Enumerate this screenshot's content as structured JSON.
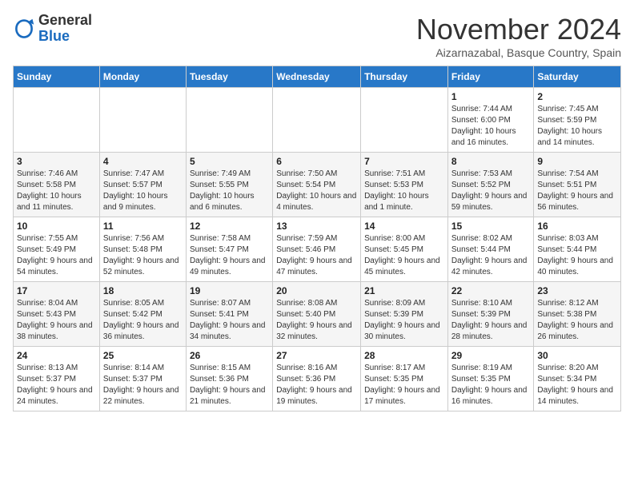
{
  "logo": {
    "general": "General",
    "blue": "Blue"
  },
  "header": {
    "month_year": "November 2024",
    "location": "Aizarnazabal, Basque Country, Spain"
  },
  "days_of_week": [
    "Sunday",
    "Monday",
    "Tuesday",
    "Wednesday",
    "Thursday",
    "Friday",
    "Saturday"
  ],
  "weeks": [
    [
      {
        "day": "",
        "info": ""
      },
      {
        "day": "",
        "info": ""
      },
      {
        "day": "",
        "info": ""
      },
      {
        "day": "",
        "info": ""
      },
      {
        "day": "",
        "info": ""
      },
      {
        "day": "1",
        "info": "Sunrise: 7:44 AM\nSunset: 6:00 PM\nDaylight: 10 hours and 16 minutes."
      },
      {
        "day": "2",
        "info": "Sunrise: 7:45 AM\nSunset: 5:59 PM\nDaylight: 10 hours and 14 minutes."
      }
    ],
    [
      {
        "day": "3",
        "info": "Sunrise: 7:46 AM\nSunset: 5:58 PM\nDaylight: 10 hours and 11 minutes."
      },
      {
        "day": "4",
        "info": "Sunrise: 7:47 AM\nSunset: 5:57 PM\nDaylight: 10 hours and 9 minutes."
      },
      {
        "day": "5",
        "info": "Sunrise: 7:49 AM\nSunset: 5:55 PM\nDaylight: 10 hours and 6 minutes."
      },
      {
        "day": "6",
        "info": "Sunrise: 7:50 AM\nSunset: 5:54 PM\nDaylight: 10 hours and 4 minutes."
      },
      {
        "day": "7",
        "info": "Sunrise: 7:51 AM\nSunset: 5:53 PM\nDaylight: 10 hours and 1 minute."
      },
      {
        "day": "8",
        "info": "Sunrise: 7:53 AM\nSunset: 5:52 PM\nDaylight: 9 hours and 59 minutes."
      },
      {
        "day": "9",
        "info": "Sunrise: 7:54 AM\nSunset: 5:51 PM\nDaylight: 9 hours and 56 minutes."
      }
    ],
    [
      {
        "day": "10",
        "info": "Sunrise: 7:55 AM\nSunset: 5:49 PM\nDaylight: 9 hours and 54 minutes."
      },
      {
        "day": "11",
        "info": "Sunrise: 7:56 AM\nSunset: 5:48 PM\nDaylight: 9 hours and 52 minutes."
      },
      {
        "day": "12",
        "info": "Sunrise: 7:58 AM\nSunset: 5:47 PM\nDaylight: 9 hours and 49 minutes."
      },
      {
        "day": "13",
        "info": "Sunrise: 7:59 AM\nSunset: 5:46 PM\nDaylight: 9 hours and 47 minutes."
      },
      {
        "day": "14",
        "info": "Sunrise: 8:00 AM\nSunset: 5:45 PM\nDaylight: 9 hours and 45 minutes."
      },
      {
        "day": "15",
        "info": "Sunrise: 8:02 AM\nSunset: 5:44 PM\nDaylight: 9 hours and 42 minutes."
      },
      {
        "day": "16",
        "info": "Sunrise: 8:03 AM\nSunset: 5:44 PM\nDaylight: 9 hours and 40 minutes."
      }
    ],
    [
      {
        "day": "17",
        "info": "Sunrise: 8:04 AM\nSunset: 5:43 PM\nDaylight: 9 hours and 38 minutes."
      },
      {
        "day": "18",
        "info": "Sunrise: 8:05 AM\nSunset: 5:42 PM\nDaylight: 9 hours and 36 minutes."
      },
      {
        "day": "19",
        "info": "Sunrise: 8:07 AM\nSunset: 5:41 PM\nDaylight: 9 hours and 34 minutes."
      },
      {
        "day": "20",
        "info": "Sunrise: 8:08 AM\nSunset: 5:40 PM\nDaylight: 9 hours and 32 minutes."
      },
      {
        "day": "21",
        "info": "Sunrise: 8:09 AM\nSunset: 5:39 PM\nDaylight: 9 hours and 30 minutes."
      },
      {
        "day": "22",
        "info": "Sunrise: 8:10 AM\nSunset: 5:39 PM\nDaylight: 9 hours and 28 minutes."
      },
      {
        "day": "23",
        "info": "Sunrise: 8:12 AM\nSunset: 5:38 PM\nDaylight: 9 hours and 26 minutes."
      }
    ],
    [
      {
        "day": "24",
        "info": "Sunrise: 8:13 AM\nSunset: 5:37 PM\nDaylight: 9 hours and 24 minutes."
      },
      {
        "day": "25",
        "info": "Sunrise: 8:14 AM\nSunset: 5:37 PM\nDaylight: 9 hours and 22 minutes."
      },
      {
        "day": "26",
        "info": "Sunrise: 8:15 AM\nSunset: 5:36 PM\nDaylight: 9 hours and 21 minutes."
      },
      {
        "day": "27",
        "info": "Sunrise: 8:16 AM\nSunset: 5:36 PM\nDaylight: 9 hours and 19 minutes."
      },
      {
        "day": "28",
        "info": "Sunrise: 8:17 AM\nSunset: 5:35 PM\nDaylight: 9 hours and 17 minutes."
      },
      {
        "day": "29",
        "info": "Sunrise: 8:19 AM\nSunset: 5:35 PM\nDaylight: 9 hours and 16 minutes."
      },
      {
        "day": "30",
        "info": "Sunrise: 8:20 AM\nSunset: 5:34 PM\nDaylight: 9 hours and 14 minutes."
      }
    ]
  ]
}
